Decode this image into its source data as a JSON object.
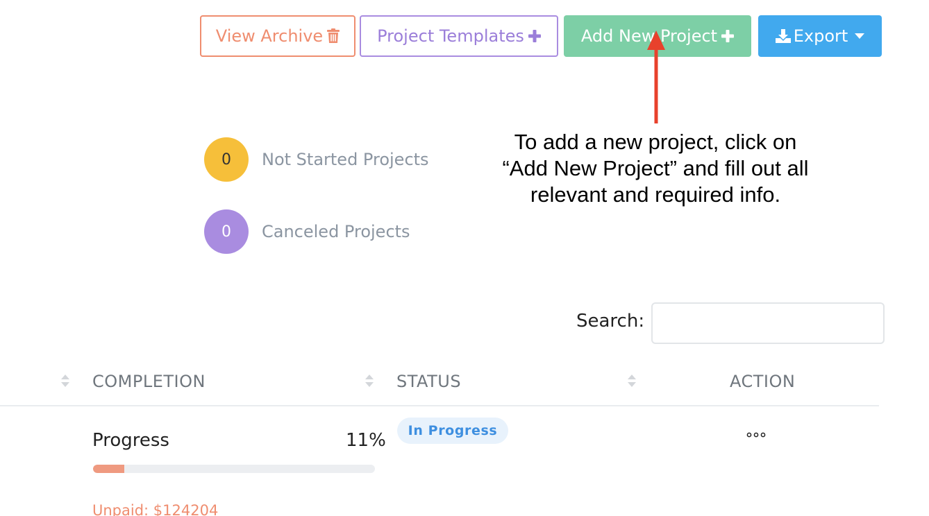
{
  "toolbar": {
    "view_archive": {
      "label": "View Archive",
      "icon": "trash-icon",
      "color": "#ef8d6f"
    },
    "project_templates": {
      "label": "Project Templates",
      "icon": "plus-icon",
      "color": "#9b7ed9"
    },
    "add_new_project": {
      "label": "Add New Project",
      "icon": "plus-icon",
      "color": "#7dcfa6"
    },
    "export": {
      "label": "Export",
      "icon": "download-icon",
      "caret": "caret-down-icon",
      "color": "#41a9ee"
    }
  },
  "annotation": {
    "text": "To add a new project, click on “Add New Project” and fill out all relevant and required info.",
    "arrow_color": "#e8412c"
  },
  "stats": [
    {
      "count": "0",
      "label": "Not Started Projects",
      "color": "#f6bf3a"
    },
    {
      "count": "0",
      "label": "Canceled Projects",
      "color": "#a98ce0"
    }
  ],
  "search": {
    "label": "Search:",
    "value": ""
  },
  "table": {
    "columns": [
      "COMPLETION",
      "STATUS",
      "ACTION"
    ],
    "rows": [
      {
        "progress_label": "Progress",
        "progress_value": "11%",
        "progress_fraction": 0.11,
        "unpaid": "Unpaid: $124204",
        "status": "In Progress",
        "action_icon": "more-horizontal-icon"
      }
    ]
  }
}
